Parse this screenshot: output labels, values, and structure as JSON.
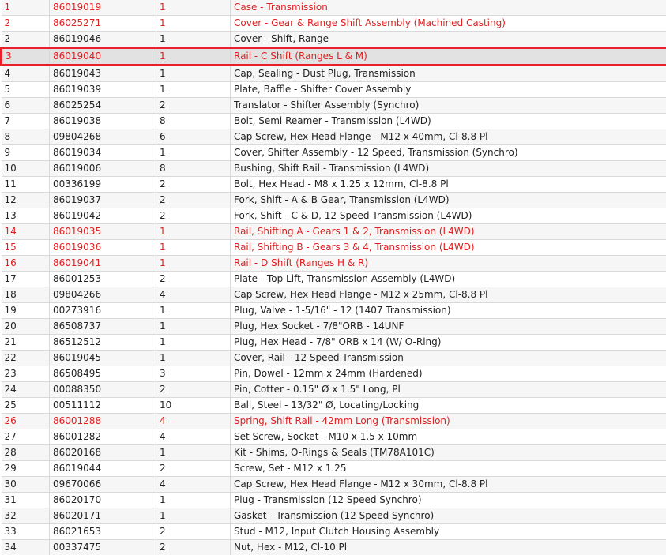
{
  "colors": {
    "highlight_text": "#e02020",
    "selection_border": "#e8202a",
    "selection_fill": "#e2e2e2",
    "row_alt": "#f6f6f6",
    "grid": "#d9d9d9"
  },
  "selected_row": 3,
  "rows": [
    {
      "ref": "1",
      "part": "86019019",
      "qty": "1",
      "desc": "Case - Transmission",
      "red": true
    },
    {
      "ref": "2",
      "part": "86025271",
      "qty": "1",
      "desc": "Cover - Gear & Range Shift Assembly (Machined Casting)",
      "red": true
    },
    {
      "ref": "2",
      "part": "86019046",
      "qty": "1",
      "desc": "Cover - Shift, Range",
      "red": false
    },
    {
      "ref": "3",
      "part": "86019040",
      "qty": "1",
      "desc": "Rail - C Shift (Ranges L & M)",
      "red": true
    },
    {
      "ref": "4",
      "part": "86019043",
      "qty": "1",
      "desc": "Cap, Sealing - Dust Plug, Transmission",
      "red": false
    },
    {
      "ref": "5",
      "part": "86019039",
      "qty": "1",
      "desc": "Plate, Baffle - Shifter Cover Assembly",
      "red": false
    },
    {
      "ref": "6",
      "part": "86025254",
      "qty": "2",
      "desc": "Translator - Shifter Assembly (Synchro)",
      "red": false
    },
    {
      "ref": "7",
      "part": "86019038",
      "qty": "8",
      "desc": "Bolt, Semi Reamer - Transmission (L4WD)",
      "red": false
    },
    {
      "ref": "8",
      "part": "09804268",
      "qty": "6",
      "desc": "Cap Screw, Hex Head Flange - M12 x 40mm, Cl-8.8 Pl",
      "red": false
    },
    {
      "ref": "9",
      "part": "86019034",
      "qty": "1",
      "desc": "Cover, Shifter Assembly - 12 Speed, Transmission (Synchro)",
      "red": false
    },
    {
      "ref": "10",
      "part": "86019006",
      "qty": "8",
      "desc": "Bushing, Shift Rail - Transmission (L4WD)",
      "red": false
    },
    {
      "ref": "11",
      "part": "00336199",
      "qty": "2",
      "desc": "Bolt, Hex Head - M8 x 1.25 x 12mm, Cl-8.8 Pl",
      "red": false
    },
    {
      "ref": "12",
      "part": "86019037",
      "qty": "2",
      "desc": "Fork, Shift - A & B Gear, Transmission (L4WD)",
      "red": false
    },
    {
      "ref": "13",
      "part": "86019042",
      "qty": "2",
      "desc": "Fork, Shift - C & D, 12 Speed Transmission (L4WD)",
      "red": false
    },
    {
      "ref": "14",
      "part": "86019035",
      "qty": "1",
      "desc": "Rail, Shifting A - Gears 1 & 2, Transmission (L4WD)",
      "red": true
    },
    {
      "ref": "15",
      "part": "86019036",
      "qty": "1",
      "desc": "Rail, Shifting B - Gears 3 & 4, Transmission (L4WD)",
      "red": true
    },
    {
      "ref": "16",
      "part": "86019041",
      "qty": "1",
      "desc": "Rail - D Shift (Ranges H & R)",
      "red": true
    },
    {
      "ref": "17",
      "part": "86001253",
      "qty": "2",
      "desc": "Plate - Top Lift, Transmission Assembly (L4WD)",
      "red": false
    },
    {
      "ref": "18",
      "part": "09804266",
      "qty": "4",
      "desc": "Cap Screw, Hex Head Flange - M12 x 25mm, Cl-8.8 Pl",
      "red": false
    },
    {
      "ref": "19",
      "part": "00273916",
      "qty": "1",
      "desc": "Plug, Valve - 1-5/16\" - 12 (1407 Transmission)",
      "red": false
    },
    {
      "ref": "20",
      "part": "86508737",
      "qty": "1",
      "desc": "Plug, Hex Socket - 7/8\"ORB - 14UNF",
      "red": false
    },
    {
      "ref": "21",
      "part": "86512512",
      "qty": "1",
      "desc": "Plug, Hex Head - 7/8\" ORB x 14 (W/ O-Ring)",
      "red": false
    },
    {
      "ref": "22",
      "part": "86019045",
      "qty": "1",
      "desc": "Cover, Rail - 12 Speed Transmission",
      "red": false
    },
    {
      "ref": "23",
      "part": "86508495",
      "qty": "3",
      "desc": "Pin, Dowel - 12mm x 24mm (Hardened)",
      "red": false
    },
    {
      "ref": "24",
      "part": "00088350",
      "qty": "2",
      "desc": "Pin, Cotter - 0.15\" Ø x 1.5\" Long, Pl",
      "red": false
    },
    {
      "ref": "25",
      "part": "00511112",
      "qty": "10",
      "desc": "Ball, Steel - 13/32\" Ø, Locating/Locking",
      "red": false
    },
    {
      "ref": "26",
      "part": "86001288",
      "qty": "4",
      "desc": "Spring, Shift Rail - 42mm Long (Transmission)",
      "red": true
    },
    {
      "ref": "27",
      "part": "86001282",
      "qty": "4",
      "desc": "Set Screw, Socket - M10 x 1.5 x 10mm",
      "red": false
    },
    {
      "ref": "28",
      "part": "86020168",
      "qty": "1",
      "desc": "Kit - Shims, O-Rings & Seals (TM78A101C)",
      "red": false
    },
    {
      "ref": "29",
      "part": "86019044",
      "qty": "2",
      "desc": "Screw, Set - M12 x 1.25",
      "red": false
    },
    {
      "ref": "30",
      "part": "09670066",
      "qty": "4",
      "desc": "Cap Screw, Hex Head Flange - M12 x 30mm, Cl-8.8 Pl",
      "red": false
    },
    {
      "ref": "31",
      "part": "86020170",
      "qty": "1",
      "desc": "Plug - Transmission (12 Speed Synchro)",
      "red": false
    },
    {
      "ref": "32",
      "part": "86020171",
      "qty": "1",
      "desc": "Gasket - Transmission (12 Speed Synchro)",
      "red": false
    },
    {
      "ref": "33",
      "part": "86021653",
      "qty": "2",
      "desc": "Stud - M12, Input Clutch Housing Assembly",
      "red": false
    },
    {
      "ref": "34",
      "part": "00337475",
      "qty": "2",
      "desc": "Nut, Hex - M12, Cl-10 Pl",
      "red": false
    }
  ]
}
